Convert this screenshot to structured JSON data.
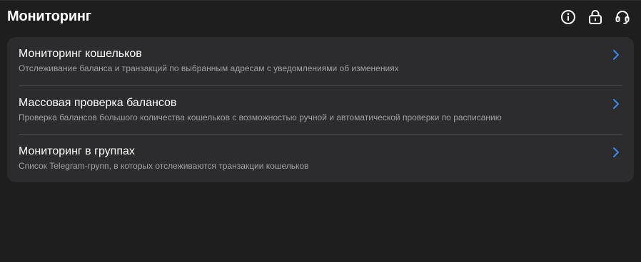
{
  "header": {
    "title": "Мониторинг",
    "icons": [
      "info-icon",
      "lock-icon",
      "support-icon"
    ]
  },
  "menu": {
    "items": [
      {
        "title": "Мониторинг кошельков",
        "subtitle": "Отслеживание баланса и транзакций по выбранным адресам с уведомлениями об изменениях"
      },
      {
        "title": "Массовая проверка балансов",
        "subtitle": "Проверка балансов большого количества кошельков с возможностью ручной и автоматической проверки по расписанию"
      },
      {
        "title": "Мониторинг в группах",
        "subtitle": "Список Telegram-групп, в которых отслеживаются транзакции кошельков"
      }
    ]
  },
  "colors": {
    "background": "#1e1e1f",
    "card": "#2c2c2e",
    "accent": "#3d8bf2",
    "subtitle": "#a0a0a6",
    "divider": "#4a4a4e"
  }
}
